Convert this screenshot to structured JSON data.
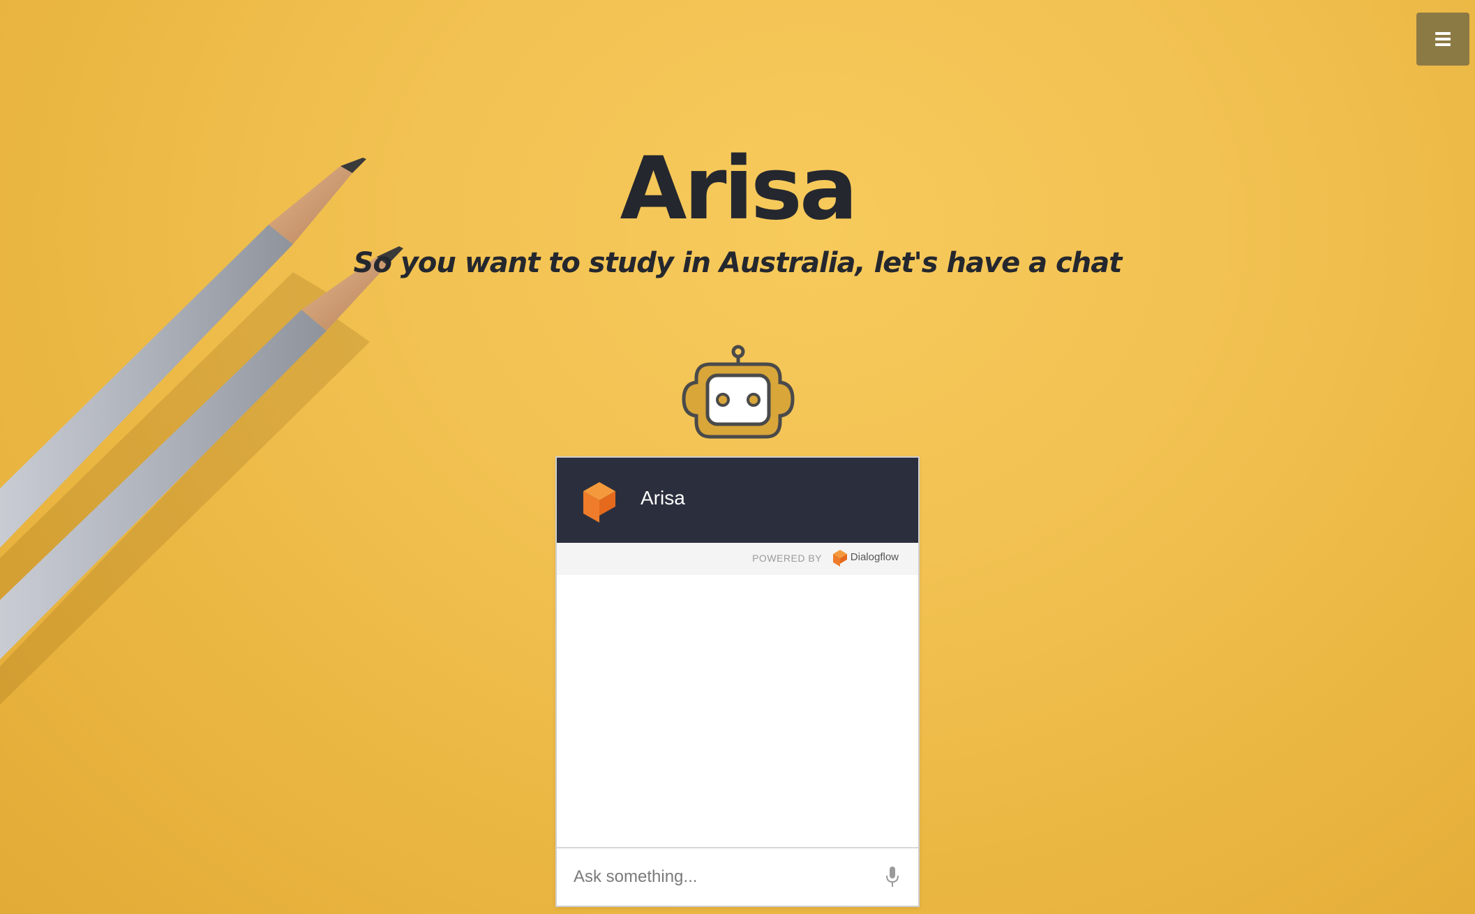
{
  "page": {
    "title": "Arisa",
    "subtitle": "So you want to study in Australia, let's have a chat"
  },
  "menu": {
    "icon": "hamburger-menu-icon"
  },
  "robot": {
    "icon": "robot-icon"
  },
  "chat": {
    "agent_name": "Arisa",
    "agent_icon": "dialogflow-cube-icon",
    "powered_by_label": "POWERED BY",
    "powered_by_brand": "Dialogflow",
    "input_placeholder": "Ask something...",
    "mic_icon": "microphone-icon"
  },
  "colors": {
    "background": "#f2c252",
    "text_dark": "#24272e",
    "chat_header": "#2b2f3d",
    "menu_button": "#8c7a45",
    "dialogflow_orange": "#ef7c2a"
  }
}
